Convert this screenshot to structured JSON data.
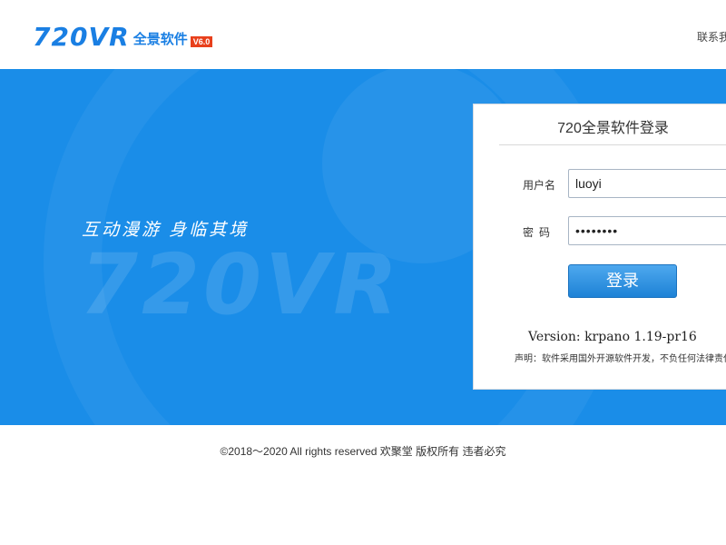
{
  "header": {
    "logo_mark": "720VR",
    "logo_text": "全景软件",
    "logo_badge": "V6.0",
    "contact_link": "联系我"
  },
  "banner": {
    "slogan": "互动漫游  身临其境",
    "watermark": "720VR"
  },
  "login": {
    "title": "720全景软件登录",
    "username_label": "用户名",
    "username_value": "luoyi",
    "password_label": "密码",
    "password_value": "••••••••",
    "submit_label": "登录",
    "version": "Version: krpano 1.19-pr16",
    "notice": "声明：软件采用国外开源软件开发，不负任何法律责任"
  },
  "footer": {
    "copyright": "©2018～2020 All rights reserved 欢聚堂 版权所有 违者必究"
  },
  "colors": {
    "brand_blue": "#1a7fe3",
    "banner_blue": "#1a8de8",
    "badge_orange": "#e8401c"
  }
}
